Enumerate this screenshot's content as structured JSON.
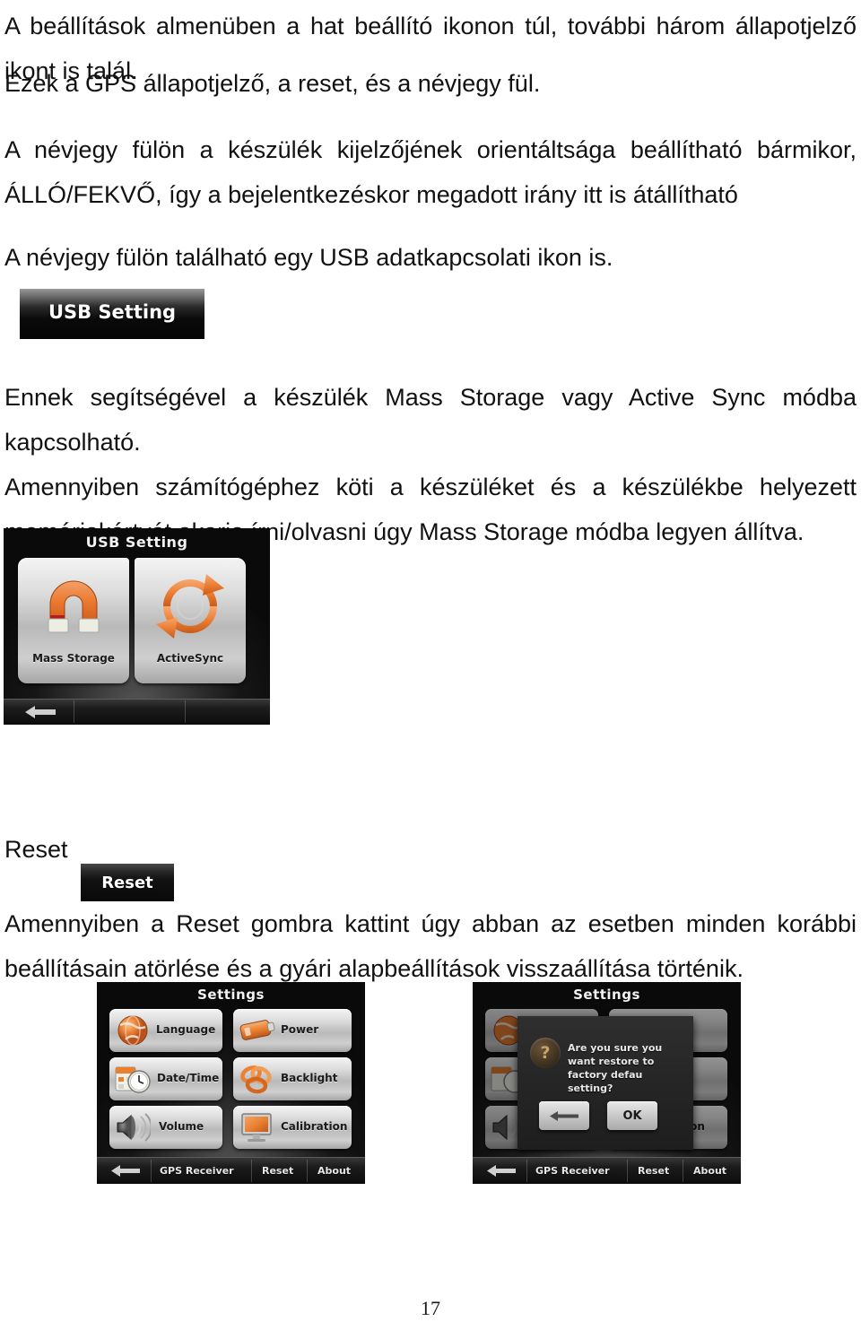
{
  "document": {
    "page_number": "17",
    "paragraphs": {
      "p1": "A beállítások almenüben a hat beállító ikonon túl, további három állapotjelző ikont is talál.",
      "p2": "Ezek a GPS állapotjelző, a reset, és a névjegy fül.",
      "p3": "A névjegy fülön a készülék kijelzőjének orientáltsága beállítható bármikor, ÁLLÓ/FEKVŐ, így a bejelentkezéskor megadott irány itt is átállítható",
      "p4": "A névjegy fülön található egy USB adatkapcsolati ikon is.",
      "p5": "Ennek segítségével a készülék Mass Storage vagy Active Sync módba kapcsolható.",
      "p6": "Amennyiben számítógéphez köti a készüléket és a készülékbe helyezett memóriakártyát akarja írni/olvasni úgy Mass Storage módba legyen állítva.",
      "p7": "Amennyiben a Reset gombra kattint úgy abban az esetben minden korábbi beállításain atörlése és a gyári alapbeállítások visszaállítása történik."
    },
    "reset_heading": "Reset"
  },
  "usb_banner": {
    "title": "USB Setting"
  },
  "reset_button": {
    "label": "Reset"
  },
  "usb_screen": {
    "title": "USB Setting",
    "tiles": [
      {
        "label": "Mass Storage",
        "icon": "magnet-icon"
      },
      {
        "label": "ActiveSync",
        "icon": "refresh-cycle-icon"
      }
    ],
    "bottombar": {
      "back_icon": "back-arrow-icon"
    }
  },
  "settings_screen": {
    "title": "Settings",
    "tiles": [
      {
        "label": "Language",
        "icon": "globe-icon"
      },
      {
        "label": "Power",
        "icon": "battery-icon"
      },
      {
        "label": "Date/Time",
        "icon": "clock-calendar-icon"
      },
      {
        "label": "Backlight",
        "icon": "rings-icon"
      },
      {
        "label": "Volume",
        "icon": "speaker-icon"
      },
      {
        "label": "Calibration",
        "icon": "monitor-icon"
      }
    ],
    "bottombar": {
      "back_icon": "back-arrow-icon",
      "items": [
        "GPS Receiver",
        "Reset",
        "About"
      ]
    }
  },
  "settings_screen_dialog": {
    "title": "Settings",
    "dialog": {
      "icon": "question-mark-icon",
      "message": "Are you sure you want restore to factory defau setting?",
      "buttons": [
        {
          "label": "",
          "icon": "back-arrow-icon"
        },
        {
          "label": "OK",
          "icon": ""
        }
      ]
    },
    "bottombar": {
      "back_icon": "back-arrow-icon",
      "items": [
        "GPS Receiver",
        "Reset",
        "About"
      ]
    }
  },
  "colors": {
    "accent_orange": "#E8742A",
    "screen_black": "#0a0a0a",
    "tile_light": "#e6e6e6"
  }
}
